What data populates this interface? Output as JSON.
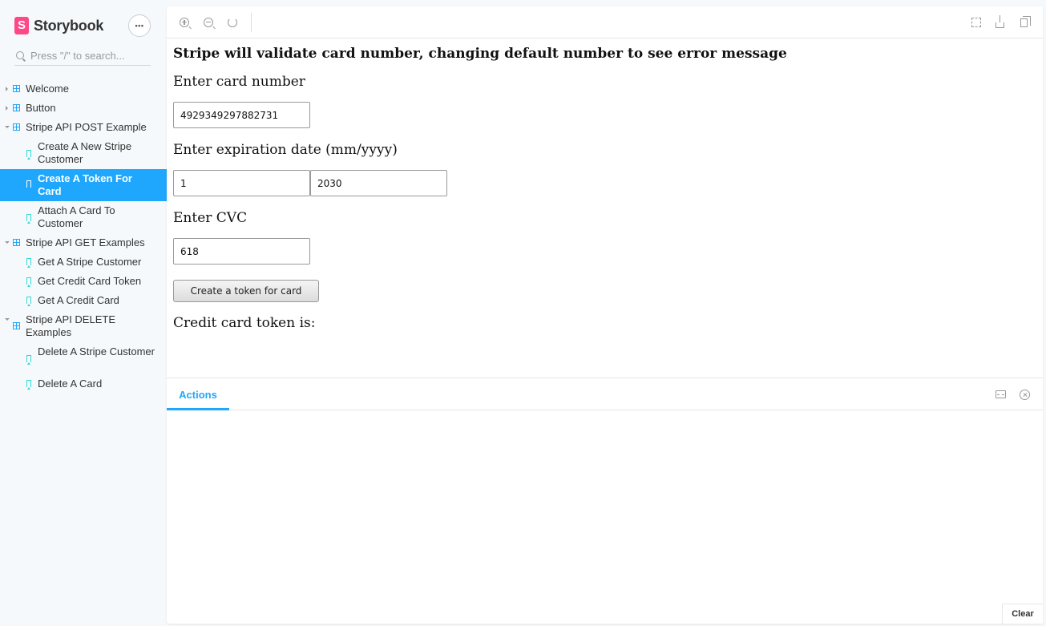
{
  "brand": {
    "logo_letter": "S",
    "name": "Storybook"
  },
  "search": {
    "placeholder": "Press \"/\" to search..."
  },
  "tree": [
    {
      "label": "Welcome",
      "type": "component",
      "expanded": false
    },
    {
      "label": "Button",
      "type": "component",
      "expanded": false
    },
    {
      "label": "Stripe API POST Example",
      "type": "component",
      "expanded": true
    },
    {
      "label": "Create A New Stripe Customer",
      "type": "story"
    },
    {
      "label": "Create A Token For Card",
      "type": "story",
      "selected": true
    },
    {
      "label": "Attach A Card To Customer",
      "type": "story"
    },
    {
      "label": "Stripe API GET Examples",
      "type": "component",
      "expanded": true
    },
    {
      "label": "Get A Stripe Customer",
      "type": "story"
    },
    {
      "label": "Get Credit Card Token",
      "type": "story"
    },
    {
      "label": "Get A Credit Card",
      "type": "story"
    },
    {
      "label": "Stripe API DELETE Examples",
      "type": "component",
      "expanded": true
    },
    {
      "label": "Delete A Stripe Customer",
      "type": "story"
    },
    {
      "label": "Delete A Card",
      "type": "story"
    }
  ],
  "preview": {
    "title": "Stripe will validate card number, changing default number to see error message",
    "card_label": "Enter card number",
    "card_value": "4929349297882731",
    "expiry_label": "Enter expiration date (mm/yyyy)",
    "expiry_month": "1",
    "expiry_year": "2030",
    "cvc_label": "Enter CVC",
    "cvc_value": "618",
    "button_label": "Create a token for card",
    "result_label": "Credit card token is:"
  },
  "addons": {
    "tab_label": "Actions",
    "clear_label": "Clear"
  },
  "colors": {
    "accent": "#1ea7fd",
    "brand": "#ff4785",
    "story_icon": "#37d5d3"
  }
}
